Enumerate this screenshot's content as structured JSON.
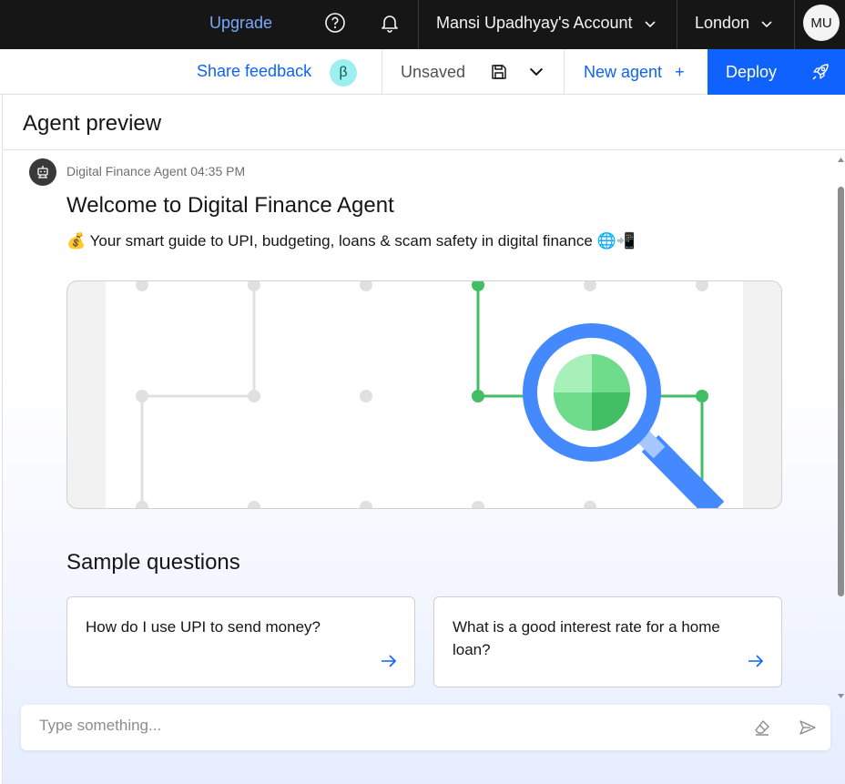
{
  "topbar": {
    "upgrade_label": "Upgrade",
    "account_label": "Mansi Upadhyay's Account",
    "region_label": "London",
    "avatar_initials": "MU",
    "icons": [
      "help-icon",
      "bell-icon",
      "chevron-down-icon"
    ]
  },
  "toolbar": {
    "share_feedback_label": "Share feedback",
    "beta_badge": "β",
    "unsaved_label": "Unsaved",
    "new_agent_label": "New agent",
    "new_agent_plus": "+",
    "deploy_label": "Deploy",
    "icons": [
      "save-icon",
      "chevron-down-icon",
      "rocket-icon"
    ]
  },
  "panel": {
    "title": "Agent preview"
  },
  "message": {
    "meta": "Digital Finance Agent 04:35 PM",
    "welcome_title": "Welcome to Digital Finance Agent",
    "subtitle": "💰 Your smart guide to UPI, budgeting, loans & scam safety in digital finance 🌐📲"
  },
  "sample_questions": {
    "title": "Sample questions",
    "items": [
      {
        "text": "How do I use UPI to send money?"
      },
      {
        "text": "What is a good interest rate for a home loan?"
      }
    ]
  },
  "composer": {
    "placeholder": "Type something...",
    "icons": [
      "eraser-icon",
      "send-icon"
    ]
  },
  "colors": {
    "topbar_bg": "#161616",
    "link_blue": "#0f62fe",
    "upgrade_blue": "#78a9ff",
    "deploy_bg": "#0f62fe",
    "beta_bg": "#9ef0f0",
    "illustration_green": "#42be65",
    "illustration_blue": "#4589ff"
  }
}
